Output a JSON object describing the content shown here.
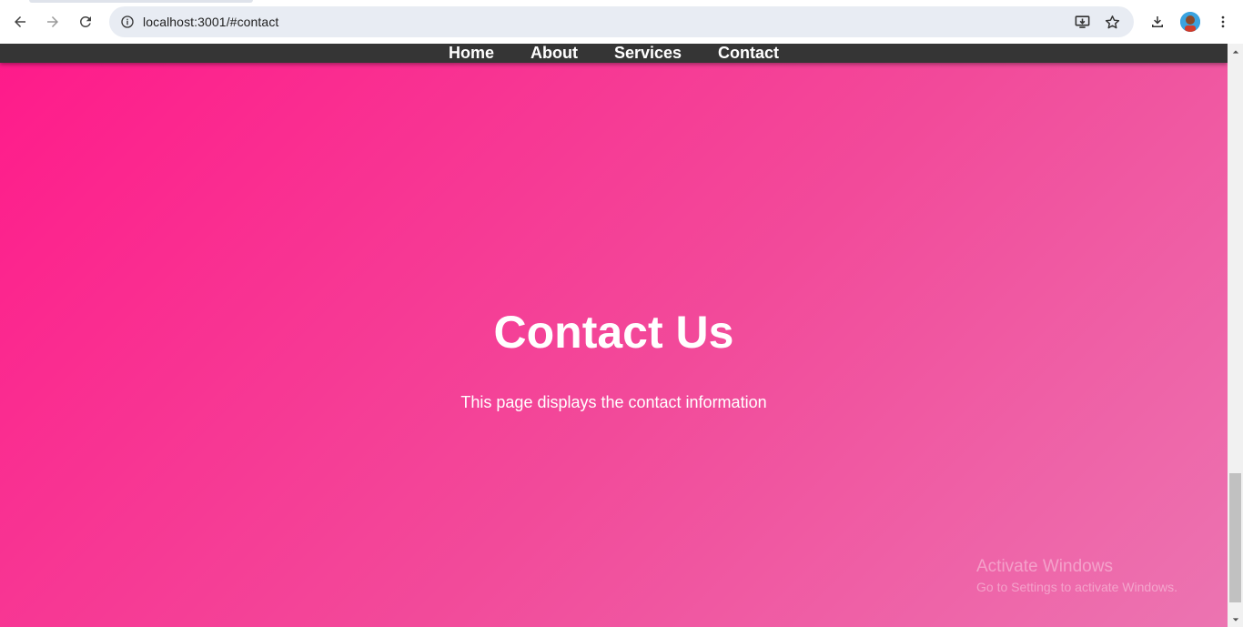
{
  "browser": {
    "url": "localhost:3001/#contact",
    "icons": {
      "back": "back-arrow-icon",
      "forward": "forward-arrow-icon",
      "reload": "reload-icon",
      "site_info": "info-icon",
      "install": "install-app-icon",
      "bookmark": "star-icon",
      "downloads": "download-icon",
      "profile": "avatar",
      "menu": "kebab-menu-icon"
    }
  },
  "nav": {
    "items": [
      {
        "label": "Home"
      },
      {
        "label": "About"
      },
      {
        "label": "Services"
      },
      {
        "label": "Contact"
      }
    ]
  },
  "main": {
    "title": "Contact Us",
    "description": "This page displays the contact information"
  },
  "watermark": {
    "title": "Activate Windows",
    "subtitle": "Go to Settings to activate Windows."
  },
  "colors": {
    "nav_bg": "#353535",
    "gradient_start": "#ff1a8a",
    "gradient_end": "#ec74b1",
    "text": "#ffffff"
  }
}
